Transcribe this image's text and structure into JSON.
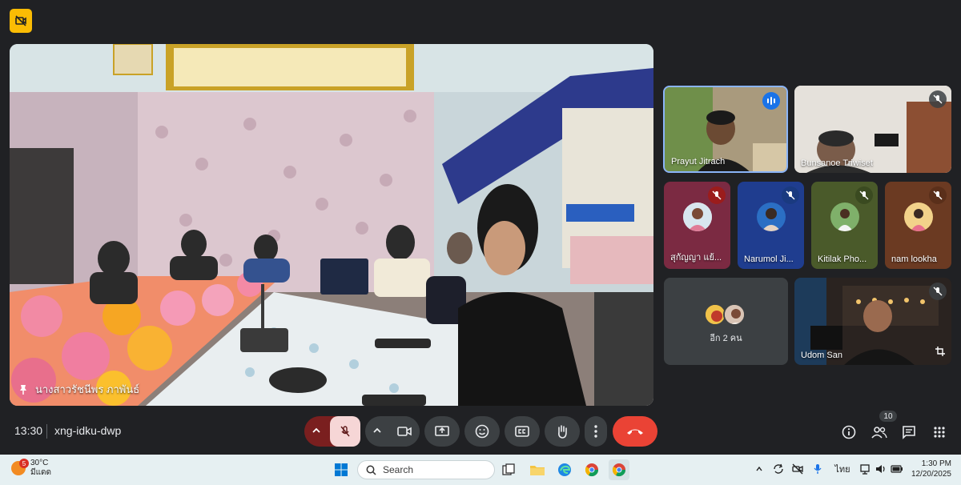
{
  "meeting": {
    "time": "13:30",
    "code": "xng-idku-dwp",
    "people_count": "10"
  },
  "main_speaker": {
    "name": "นางสาวรัชนีพร ภาพันธ์"
  },
  "participants": [
    {
      "name": "Prayut Jitrach",
      "active": true
    },
    {
      "name": "Bunsanoe Triwiset",
      "muted": true
    },
    {
      "name": "สุกัญญา แย้...",
      "muted": true
    },
    {
      "name": "Narumol Ji...",
      "muted": true
    },
    {
      "name": "Kitilak Pho...",
      "muted": true
    },
    {
      "name": "nam lookha",
      "muted": true
    },
    {
      "name": "อีก 2 คน"
    },
    {
      "name": "Udom San",
      "muted": true
    }
  ],
  "taskbar": {
    "weather_temp": "30°C",
    "weather_desc": "มีแดด",
    "weather_badge": "5",
    "search_label": "Search",
    "language": "ไทย",
    "clock_time": "1:30 PM",
    "clock_date": "12/20/2025"
  },
  "colors": {
    "background": "#202124",
    "control_bg": "#3c4043",
    "end_call": "#ea4335",
    "mic_off_red": "#9b1c1c",
    "active_blue": "#1a73e8",
    "rec_yellow": "#fbbc04"
  }
}
